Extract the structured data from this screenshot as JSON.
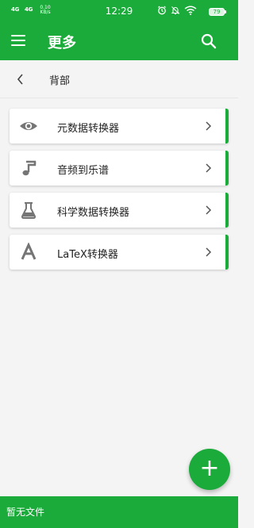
{
  "status_bar": {
    "signal_1": "4G",
    "signal_2": "4G",
    "network_speed_value": "0.10",
    "network_speed_unit": "KB/s",
    "time": "12:29",
    "battery": "79"
  },
  "app_bar": {
    "title": "更多"
  },
  "breadcrumb": {
    "label": "背部"
  },
  "tools": [
    {
      "label": "元数据转换器",
      "icon": "eye-icon"
    },
    {
      "label": "音频到乐谱",
      "icon": "music-note-icon"
    },
    {
      "label": "科学数据转换器",
      "icon": "flask-icon"
    },
    {
      "label": "LaTeX转换器",
      "icon": "font-a-icon"
    }
  ],
  "bottom_bar": {
    "text": "暂无文件"
  },
  "fab": {
    "symbol": "+"
  },
  "colors": {
    "primary": "#1bab3a",
    "background": "#f4f4f4",
    "icon_gray": "#757575"
  }
}
